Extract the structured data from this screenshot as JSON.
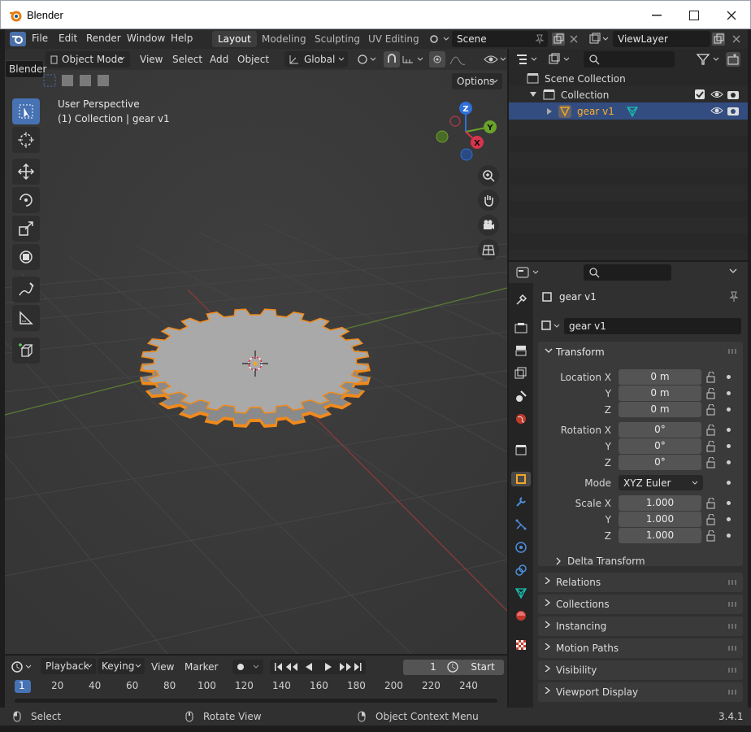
{
  "window": {
    "title": "Blender"
  },
  "menu": {
    "items": [
      "File",
      "Edit",
      "Render",
      "Window",
      "Help"
    ]
  },
  "workspaces": [
    {
      "label": "Layout",
      "active": true
    },
    {
      "label": "Modeling",
      "active": false
    },
    {
      "label": "Sculpting",
      "active": false
    },
    {
      "label": "UV Editing",
      "active": false
    }
  ],
  "scene": {
    "name": "Scene"
  },
  "viewlayer": {
    "name": "ViewLayer"
  },
  "tooltip": {
    "text": "Blender"
  },
  "viewport_header": {
    "mode": "Object Mode",
    "menus": [
      "View",
      "Select",
      "Add",
      "Object"
    ],
    "orientation": "Global",
    "options": "Options"
  },
  "viewport": {
    "perspective": "User Perspective",
    "collection_info": "(1) Collection | gear v1"
  },
  "gizmo": {
    "z": "Z",
    "y": "Y",
    "x": "X"
  },
  "outliner": {
    "scene_collection": "Scene Collection",
    "collection": "Collection",
    "object": "gear v1"
  },
  "properties": {
    "object_name": "gear v1",
    "object_field": "gear v1",
    "transform": "Transform",
    "location_label": "Location X",
    "loc_y_label": "Y",
    "loc_z_label": "Z",
    "location": [
      "0 m",
      "0 m",
      "0 m"
    ],
    "rotation_label": "Rotation X",
    "rot_y_label": "Y",
    "rot_z_label": "Z",
    "rotation": [
      "0°",
      "0°",
      "0°"
    ],
    "mode_label": "Mode",
    "mode_value": "XYZ Euler",
    "scale_label": "Scale X",
    "scale_y_label": "Y",
    "scale_z_label": "Z",
    "scale": [
      "1.000",
      "1.000",
      "1.000"
    ],
    "delta": "Delta Transform",
    "panels": [
      "Relations",
      "Collections",
      "Instancing",
      "Motion Paths",
      "Visibility",
      "Viewport Display"
    ]
  },
  "timeline": {
    "menus": [
      "Playback",
      "Keying",
      "View",
      "Marker"
    ],
    "frame": "1",
    "start": "Start",
    "ruler": [
      "1",
      "20",
      "40",
      "60",
      "80",
      "100",
      "120",
      "140",
      "160",
      "180",
      "200",
      "220",
      "240"
    ]
  },
  "status": {
    "left": "Select",
    "middle": "Rotate View",
    "right": "Object Context Menu",
    "version": "3.4.1"
  }
}
